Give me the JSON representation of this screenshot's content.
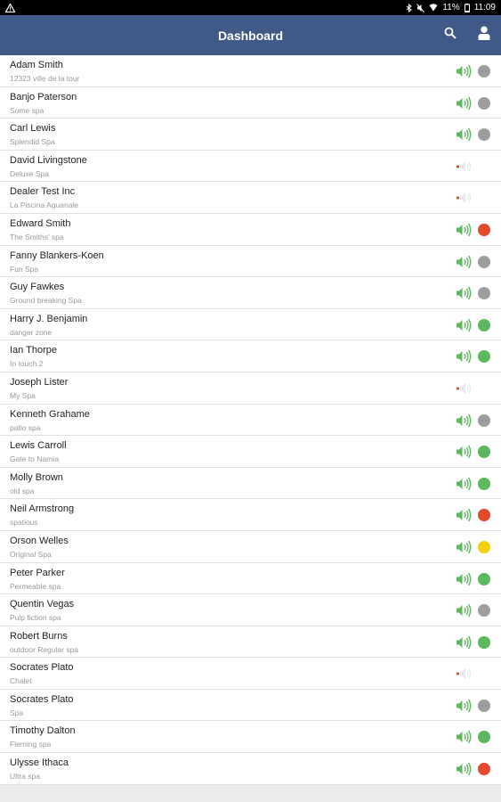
{
  "status_bar": {
    "left_icon": "warning-icon",
    "battery": "11%",
    "time": "11:09"
  },
  "app_bar": {
    "title": "Dashboard",
    "search_icon": "search-icon",
    "account_icon": "account-icon"
  },
  "colors": {
    "app_bar": "#3f5a87",
    "green": "#5cb85c",
    "grey": "#9e9e9e",
    "red": "#e2492f",
    "yellow": "#f2d00f",
    "speaker_on": "#5cb85c",
    "speaker_off": "#e8e8e8"
  },
  "rows": [
    {
      "name": "Adam Smith",
      "sub": "12323 ville de la tour",
      "online": true,
      "status": "grey"
    },
    {
      "name": "Banjo Paterson",
      "sub": "Some spa",
      "online": true,
      "status": "grey"
    },
    {
      "name": "Carl Lewis",
      "sub": "Splendid Spa",
      "online": true,
      "status": "grey"
    },
    {
      "name": "David Livingstone",
      "sub": "Deluxe Spa",
      "online": false,
      "status": "none"
    },
    {
      "name": "Dealer Test Inc",
      "sub": "La Piscina Aquanale",
      "online": false,
      "status": "none"
    },
    {
      "name": "Edward Smith",
      "sub": "The Smiths' spa",
      "online": true,
      "status": "red"
    },
    {
      "name": "Fanny Blankers-Koen",
      "sub": "Fun Spa",
      "online": true,
      "status": "grey"
    },
    {
      "name": "Guy Fawkes",
      "sub": "Ground breaking Spa",
      "online": true,
      "status": "grey"
    },
    {
      "name": "Harry J. Benjamin",
      "sub": "danger zone",
      "online": true,
      "status": "green"
    },
    {
      "name": "Ian Thorpe",
      "sub": "In touch 2",
      "online": true,
      "status": "green"
    },
    {
      "name": "Joseph Lister",
      "sub": "My Spa",
      "online": false,
      "status": "none"
    },
    {
      "name": "Kenneth Grahame",
      "sub": "patio spa",
      "online": true,
      "status": "grey"
    },
    {
      "name": "Lewis Carroll",
      "sub": "Gate to Narnia",
      "online": true,
      "status": "green"
    },
    {
      "name": "Molly Brown",
      "sub": "old spa",
      "online": true,
      "status": "green"
    },
    {
      "name": "Neil Armstrong",
      "sub": "spatious",
      "online": true,
      "status": "red"
    },
    {
      "name": "Orson Welles",
      "sub": "Original Spa",
      "online": true,
      "status": "yellow"
    },
    {
      "name": "Peter Parker",
      "sub": "Permeable spa",
      "online": true,
      "status": "green"
    },
    {
      "name": "Quentin Vegas",
      "sub": "Pulp fiction spa",
      "online": true,
      "status": "grey"
    },
    {
      "name": "Robert Burns",
      "sub": "outdoor Regular spa",
      "online": true,
      "status": "green"
    },
    {
      "name": "Socrates Plato",
      "sub": "Chalet",
      "online": false,
      "status": "none"
    },
    {
      "name": "Socrates Plato",
      "sub": "Spa",
      "online": true,
      "status": "grey"
    },
    {
      "name": "Timothy Dalton",
      "sub": "Fleming spa",
      "online": true,
      "status": "green"
    },
    {
      "name": "Ulysse Ithaca",
      "sub": "Ultra spa",
      "online": true,
      "status": "red"
    }
  ]
}
